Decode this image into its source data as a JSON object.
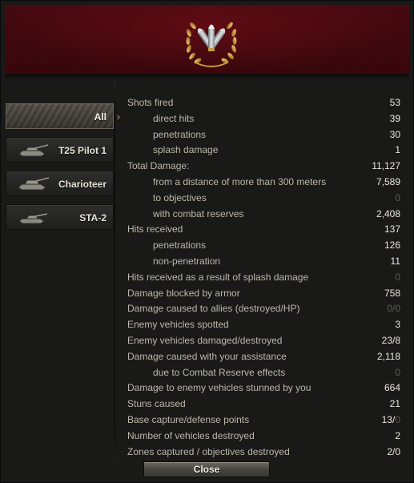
{
  "badge": {
    "icon": "shells-laurel-wreath-icon"
  },
  "colors": {
    "header_red": "#4a0a12",
    "accent_gold": "#c8a35c",
    "value_text": "#ece8dc",
    "label_text": "#bdb8aa",
    "zero_text": "#5f5c55"
  },
  "tabs": [
    {
      "label": "All",
      "selected": true,
      "icon": ""
    },
    {
      "label": "T25 Pilot 1",
      "selected": false,
      "icon": "tank-icon"
    },
    {
      "label": "Charioteer",
      "selected": false,
      "icon": "tank-icon"
    },
    {
      "label": "STA-2",
      "selected": false,
      "icon": "tank-icon"
    }
  ],
  "stats": [
    {
      "label": "Shots fired",
      "value": "53",
      "indent": false
    },
    {
      "label": "direct hits",
      "value": "39",
      "indent": true
    },
    {
      "label": "penetrations",
      "value": "30",
      "indent": true
    },
    {
      "label": "splash damage",
      "value": "1",
      "indent": true
    },
    {
      "label": "Total Damage:",
      "value": "11,127",
      "indent": false
    },
    {
      "label": "from a distance of more than 300 meters",
      "value": "7,589",
      "indent": true
    },
    {
      "label": "to objectives",
      "value": "0",
      "indent": true,
      "muted": true
    },
    {
      "label": "with combat reserves",
      "value": "2,408",
      "indent": true
    },
    {
      "label": "Hits received",
      "value": "137",
      "indent": false
    },
    {
      "label": "penetrations",
      "value": "126",
      "indent": true
    },
    {
      "label": "non-penetration",
      "value": "11",
      "indent": true
    },
    {
      "label": "Hits received as a result of splash damage",
      "value": "0",
      "indent": false,
      "muted": true
    },
    {
      "label": "Damage blocked by armor",
      "value": "758",
      "indent": false
    },
    {
      "label": "Damage caused to allies (destroyed/HP)",
      "value": "0/0",
      "indent": false,
      "muted": true
    },
    {
      "label": "Enemy vehicles spotted",
      "value": "3",
      "indent": false
    },
    {
      "label": "Enemy vehicles damaged/destroyed",
      "value": "23/8",
      "indent": false
    },
    {
      "label": "Damage caused with your assistance",
      "value": "2,118",
      "indent": false
    },
    {
      "label": "due to Combat Reserve effects",
      "value": "0",
      "indent": true,
      "muted": true
    },
    {
      "label": "Damage to enemy vehicles stunned by you",
      "value": "664",
      "indent": false
    },
    {
      "label": "Stuns caused",
      "value": "21",
      "indent": false
    },
    {
      "label": "Base capture/defense points",
      "value": "13/0",
      "indent": false,
      "split": [
        "13/",
        "0"
      ]
    },
    {
      "label": "Number of vehicles destroyed",
      "value": "2",
      "indent": false
    },
    {
      "label": "Zones captured / objectives destroyed",
      "value": "2/0",
      "indent": false
    }
  ],
  "close_label": "Close"
}
